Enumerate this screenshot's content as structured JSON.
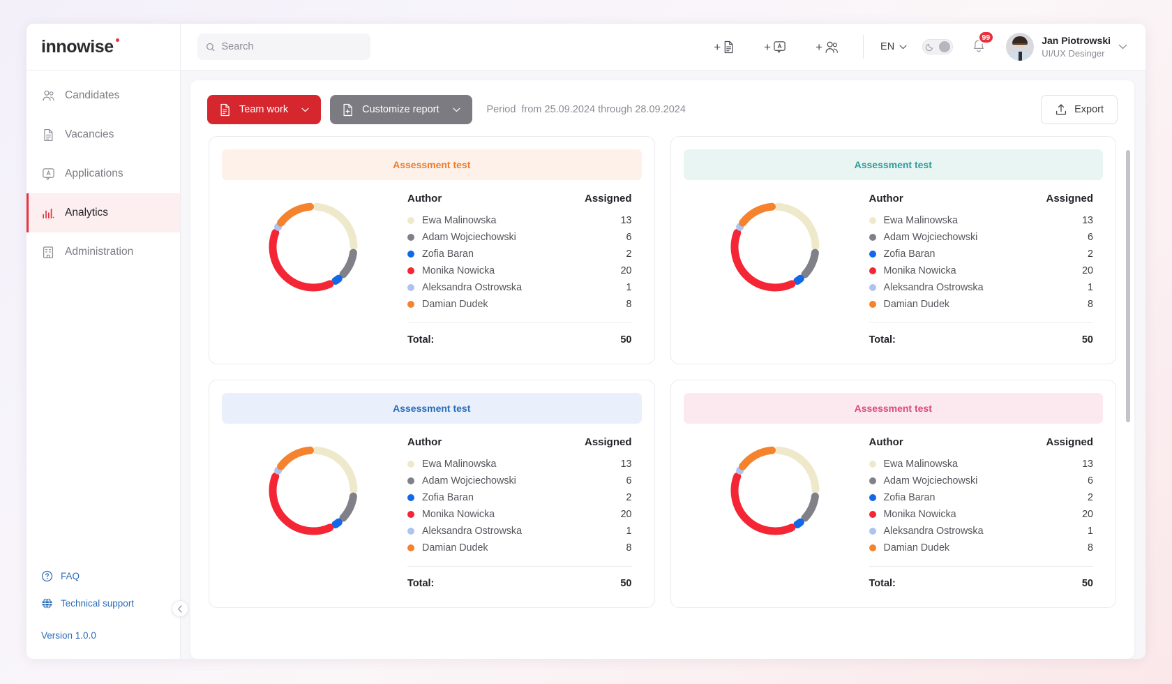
{
  "header": {
    "logo_text": "innowise",
    "search": {
      "placeholder": "Search",
      "value": ""
    },
    "quick_actions": [
      {
        "name": "add-document",
        "label": "+"
      },
      {
        "name": "add-application",
        "label": "+"
      },
      {
        "name": "add-candidate",
        "label": "+"
      }
    ],
    "language": "EN",
    "notifications_badge": "99",
    "user": {
      "name": "Jan Piotrowski",
      "role": "UI/UX Desinger"
    }
  },
  "sidebar": {
    "items": [
      {
        "label": "Candidates",
        "icon": "users-icon",
        "active": false
      },
      {
        "label": "Vacancies",
        "icon": "document-icon",
        "active": false
      },
      {
        "label": "Applications",
        "icon": "application-icon",
        "active": false
      },
      {
        "label": "Analytics",
        "icon": "bar-chart-icon",
        "active": true
      },
      {
        "label": "Administration",
        "icon": "building-icon",
        "active": false
      }
    ],
    "faq_label": "FAQ",
    "support_label": "Technical support",
    "version_label": "Version",
    "version_value": "1.0.0"
  },
  "toolbar": {
    "team_work_label": "Team work",
    "customize_report_label": "Customize report",
    "period_label": "Period",
    "period_value": "from 25.09.2024 through 28.09.2024",
    "export_label": "Export"
  },
  "table_headers": {
    "author": "Author",
    "assigned": "Assigned",
    "total": "Total:"
  },
  "colors": {
    "brand_red": "#e8313c",
    "accent_orange": "#f07b2b",
    "accent_teal": "#2a9d9b",
    "accent_blue": "#2b6cb8",
    "accent_pink": "#d94a7a",
    "series_cream": "#efe9cc",
    "series_gray": "#808088",
    "series_blue": "#1268e8",
    "series_red": "#f42534",
    "series_periwinkle": "#aec3ef",
    "series_orange": "#f5832e"
  },
  "chart_data": [
    {
      "type": "pie",
      "title": "Assessment test",
      "accent": "#f07b2b",
      "accent_bg": "#fdf1ea",
      "categories": [
        "Ewa Malinowska",
        "Adam Wojciechowski",
        "Zofia Baran",
        "Monika Nowicka",
        "Aleksandra Ostrowska",
        "Damian Dudek"
      ],
      "values": [
        13,
        6,
        2,
        20,
        1,
        8
      ],
      "colors": [
        "#efe9cc",
        "#808088",
        "#1268e8",
        "#f42534",
        "#aec3ef",
        "#f5832e"
      ],
      "total": 50,
      "legend": "right"
    },
    {
      "type": "pie",
      "title": "Assessment test",
      "accent": "#2a9d9b",
      "accent_bg": "#e9f5f3",
      "categories": [
        "Ewa Malinowska",
        "Adam Wojciechowski",
        "Zofia Baran",
        "Monika Nowicka",
        "Aleksandra Ostrowska",
        "Damian Dudek"
      ],
      "values": [
        13,
        6,
        2,
        20,
        1,
        8
      ],
      "colors": [
        "#efe9cc",
        "#808088",
        "#1268e8",
        "#f42534",
        "#aec3ef",
        "#f5832e"
      ],
      "total": 50,
      "legend": "right"
    },
    {
      "type": "pie",
      "title": "Assessment test",
      "accent": "#2b6cb8",
      "accent_bg": "#e9f0fb",
      "categories": [
        "Ewa Malinowska",
        "Adam Wojciechowski",
        "Zofia Baran",
        "Monika Nowicka",
        "Aleksandra Ostrowska",
        "Damian Dudek"
      ],
      "values": [
        13,
        6,
        2,
        20,
        1,
        8
      ],
      "colors": [
        "#efe9cc",
        "#808088",
        "#1268e8",
        "#f42534",
        "#aec3ef",
        "#f5832e"
      ],
      "total": 50,
      "legend": "right"
    },
    {
      "type": "pie",
      "title": "Assessment test",
      "accent": "#d94a7a",
      "accent_bg": "#fce9ef",
      "categories": [
        "Ewa Malinowska",
        "Adam Wojciechowski",
        "Zofia Baran",
        "Monika Nowicka",
        "Aleksandra Ostrowska",
        "Damian Dudek"
      ],
      "values": [
        13,
        6,
        2,
        20,
        1,
        8
      ],
      "colors": [
        "#efe9cc",
        "#808088",
        "#1268e8",
        "#f42534",
        "#aec3ef",
        "#f5832e"
      ],
      "total": 50,
      "legend": "right"
    }
  ]
}
